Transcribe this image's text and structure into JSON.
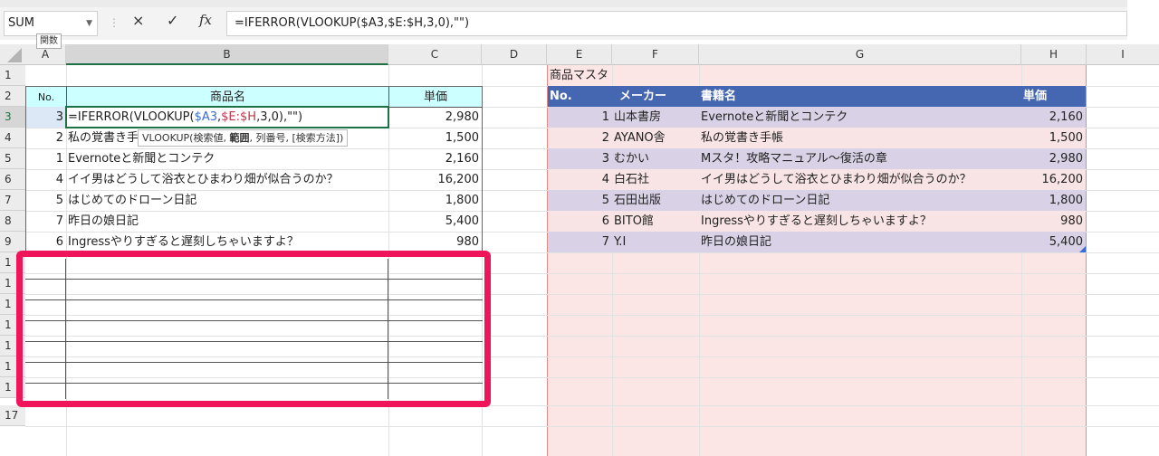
{
  "formula_bar": {
    "name_box": "SUM",
    "cancel_icon": "×",
    "enter_icon": "✓",
    "fx_icon": "fx",
    "formula": "=IFERROR(VLOOKUP($A3,$E:$H,3,0),\"\")",
    "tooltip_func": "関数"
  },
  "columns": [
    "A",
    "B",
    "C",
    "D",
    "E",
    "F",
    "G",
    "H",
    "I"
  ],
  "rows": [
    "1",
    "2",
    "3",
    "4",
    "5",
    "6",
    "7",
    "8",
    "9",
    "1",
    "1",
    "1",
    "1",
    "1",
    "1",
    "1",
    "17"
  ],
  "left_table": {
    "header_no": "No.",
    "header_name": "商品名",
    "header_price": "単価",
    "editing": {
      "a": "3",
      "prefix": "=IFERROR(VLOOKUP(",
      "ref1": "$A3",
      "comma1": ",",
      "ref2": "$E:$H",
      "suffix": ",3,0),\"\")",
      "price": "2,980"
    },
    "rows": [
      {
        "a": "2",
        "b": "私の覚書き手帳",
        "c": "1,500"
      },
      {
        "a": "1",
        "b": "Evernoteと新聞とコンテク",
        "c": "2,160"
      },
      {
        "a": "4",
        "b": "イイ男はどうして浴衣とひまわり畑が似合うのか？",
        "c": "16,200"
      },
      {
        "a": "5",
        "b": "はじめてのドローン日記",
        "c": "1,800"
      },
      {
        "a": "7",
        "b": "昨日の娘日記",
        "c": "5,400"
      },
      {
        "a": "6",
        "b": "Ingressやりすぎると遅刻しちゃいますよ？",
        "c": "980"
      }
    ]
  },
  "autocomplete_tip": {
    "prefix": "VLOOKUP(検索値, ",
    "bold": "範囲",
    "suffix": ", 列番号, [検索方法])"
  },
  "master": {
    "title": "商品マスタ",
    "headers": [
      "No.",
      "メーカー",
      "書籍名",
      "単価"
    ],
    "rows": [
      {
        "no": "1",
        "maker": "山本書房",
        "title": "Evernoteと新聞とコンテク",
        "price": "2,160"
      },
      {
        "no": "2",
        "maker": "AYANO舎",
        "title": "私の覚書き手帳",
        "price": "1,500"
      },
      {
        "no": "3",
        "maker": "むかい",
        "title": "Mスタ！攻略マニュアル〜復活の章",
        "price": "2,980"
      },
      {
        "no": "4",
        "maker": "白石社",
        "title": "イイ男はどうして浴衣とひまわり畑が似合うのか？",
        "price": "16,200"
      },
      {
        "no": "5",
        "maker": "石田出版",
        "title": "はじめてのドローン日記",
        "price": "1,800"
      },
      {
        "no": "6",
        "maker": "BITO館",
        "title": "Ingressやりすぎると遅刻しちゃいますよ？",
        "price": "980"
      },
      {
        "no": "7",
        "maker": "Y.I",
        "title": "昨日の娘日記",
        "price": "5,400"
      }
    ]
  },
  "colors": {
    "accent_green": "#1f7145",
    "annotation": "#f0145a",
    "master_header": "#4566b0",
    "ref_blue": "#3b6bd6",
    "ref_red": "#c2334a"
  }
}
